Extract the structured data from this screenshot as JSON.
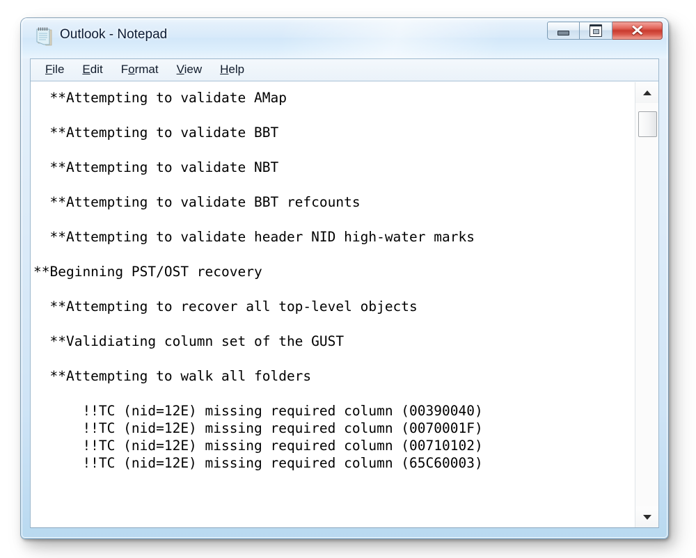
{
  "window": {
    "title": "Outlook - Notepad",
    "icon": "notepad-icon",
    "controls": {
      "minimize": "—",
      "maximize": "❐",
      "close": "✕"
    }
  },
  "menu": {
    "items": [
      {
        "label": "File",
        "accel_index": 0
      },
      {
        "label": "Edit",
        "accel_index": 0
      },
      {
        "label": "Format",
        "accel_index": 1
      },
      {
        "label": "View",
        "accel_index": 0
      },
      {
        "label": "Help",
        "accel_index": 0
      }
    ]
  },
  "document": {
    "lines": [
      "  **Attempting to validate AMap",
      "",
      "  **Attempting to validate BBT",
      "",
      "  **Attempting to validate NBT",
      "",
      "  **Attempting to validate BBT refcounts",
      "",
      "  **Attempting to validate header NID high-water marks",
      "",
      "**Beginning PST/OST recovery",
      "",
      "  **Attempting to recover all top-level objects",
      "",
      "  **Validiating column set of the GUST",
      "",
      "  **Attempting to walk all folders",
      "",
      "      !!TC (nid=12E) missing required column (00390040)",
      "      !!TC (nid=12E) missing required column (0070001F)",
      "      !!TC (nid=12E) missing required column (00710102)",
      "      !!TC (nid=12E) missing required column (65C60003)"
    ]
  },
  "scrollbar": {
    "up_arrow": "▲",
    "down_arrow": "▼",
    "thumb_position_pct": 2,
    "thumb_size_pct": 6
  },
  "colors": {
    "frame_glass": "#cfe4f6",
    "titlebar_text": "#0c1b33",
    "close_button": "#c93b2f",
    "client_background": "#ffffff",
    "text": "#000000",
    "menu_background": "#eaf2f9"
  }
}
